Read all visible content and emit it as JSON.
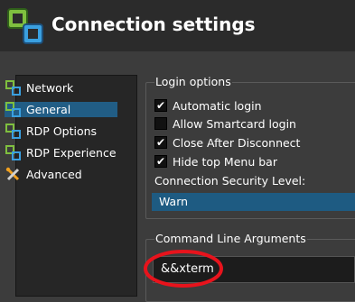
{
  "header": {
    "title": "Connection settings"
  },
  "sidebar": {
    "items": [
      {
        "label": "Network",
        "icon": "network-icon"
      },
      {
        "label": "General",
        "icon": "general-icon",
        "selected": true
      },
      {
        "label": "RDP Options",
        "icon": "rdp-options-icon"
      },
      {
        "label": "RDP Experience",
        "icon": "rdp-experience-icon"
      },
      {
        "label": "Advanced",
        "icon": "tools-icon"
      }
    ]
  },
  "login_options": {
    "title": "Login options",
    "checkboxes": [
      {
        "label": "Automatic login",
        "checked": true
      },
      {
        "label": "Allow Smartcard login",
        "checked": false
      },
      {
        "label": "Close After Disconnect",
        "checked": true
      },
      {
        "label": "Hide top Menu bar",
        "checked": true
      }
    ],
    "security_label": "Connection Security Level:",
    "security_value": "Warn"
  },
  "command_line": {
    "title": "Command Line Arguments",
    "value": "&&xterm"
  },
  "colors": {
    "selection": "#215d85",
    "annotation": "#e8131c"
  }
}
